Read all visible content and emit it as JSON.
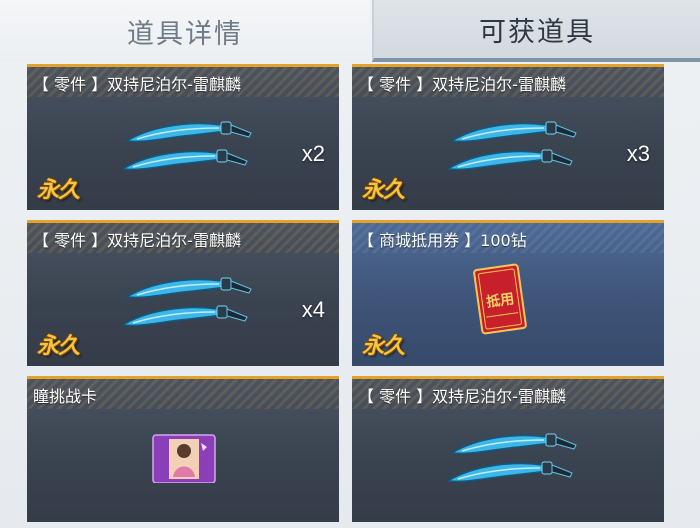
{
  "tabs": {
    "details": "道具详情",
    "obtainable": "可获道具"
  },
  "items": [
    {
      "title": "【 零件 】双持尼泊尔-雷麒麟",
      "qty": "x2",
      "badge": "永久",
      "icon": "dual-blade-icon"
    },
    {
      "title": "【 零件 】双持尼泊尔-雷麒麟",
      "qty": "x3",
      "badge": "永久",
      "icon": "dual-blade-icon"
    },
    {
      "title": "【 零件 】双持尼泊尔-雷麒麟",
      "qty": "x4",
      "badge": "永久",
      "icon": "dual-blade-icon"
    },
    {
      "title": "【 商城抵用券 】100钻",
      "qty": "",
      "badge": "永久",
      "icon": "voucher-icon",
      "voucher_text": "抵用"
    },
    {
      "title": "瞳挑战卡",
      "qty": "",
      "badge": "",
      "icon": "challenge-card-icon"
    },
    {
      "title": "【 零件 】双持尼泊尔-雷麒麟",
      "qty": "",
      "badge": "",
      "icon": "dual-blade-icon"
    }
  ],
  "colors": {
    "accent_gold": "#e3a229",
    "card_dark": "#3a4350",
    "card_blue": "#3e5478",
    "badge_gold": "#f6c441"
  }
}
